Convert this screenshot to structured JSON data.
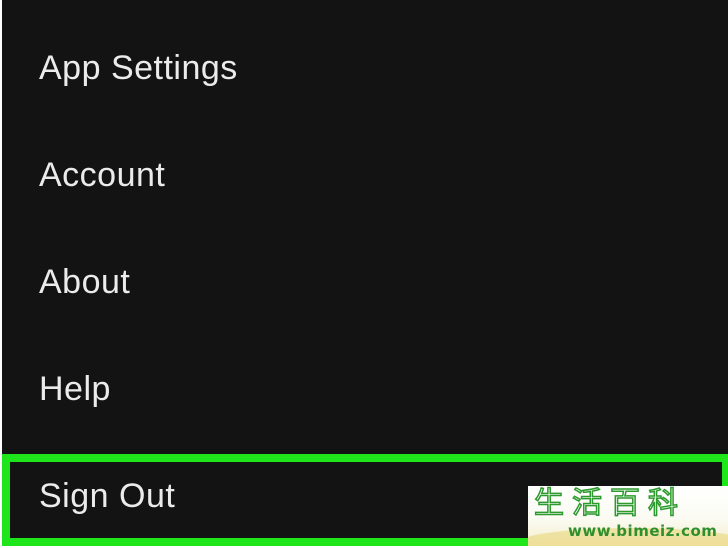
{
  "menu": {
    "items": [
      {
        "label": "App Settings"
      },
      {
        "label": "Account"
      },
      {
        "label": "About"
      },
      {
        "label": "Help"
      },
      {
        "label": "Sign Out"
      }
    ],
    "highlighted_item": "Sign Out",
    "highlight_color": "#1fe61a",
    "background_color": "#141314",
    "text_color": "#ebebeb"
  },
  "watermark": {
    "title": "生活百科",
    "url": "www.bimeiz.com"
  }
}
